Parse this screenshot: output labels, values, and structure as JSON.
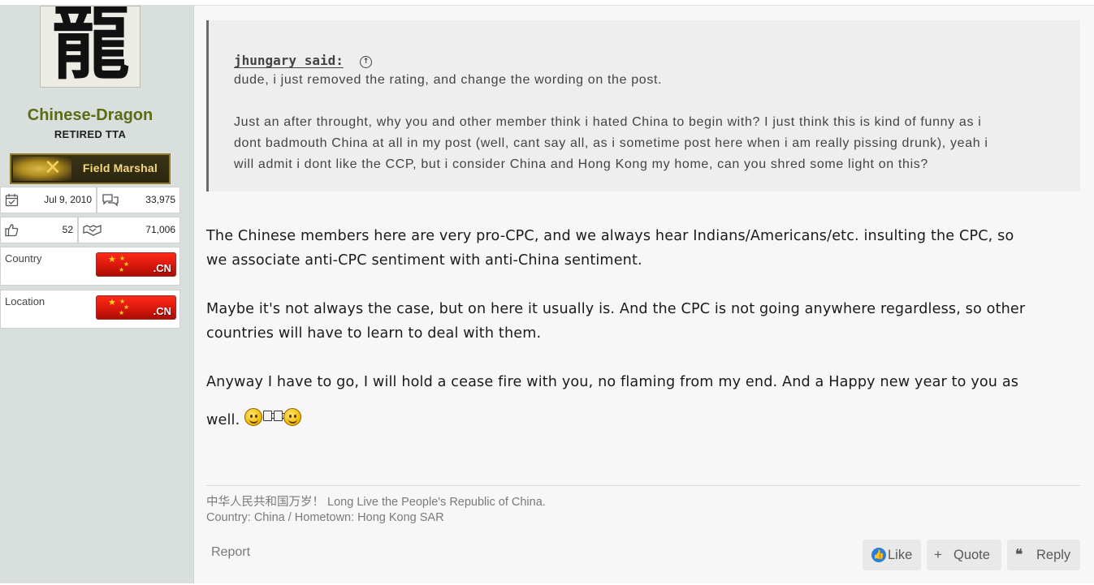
{
  "user": {
    "avatar_glyph": "龍",
    "name": "Chinese-Dragon",
    "title": "RETIRED TTA",
    "rank_label": "Field Marshal",
    "joined": "Jul 9, 2010",
    "messages": "33,975",
    "reactions": "52",
    "points": "71,006",
    "country_label": "Country",
    "country_flag_text": ".CN",
    "location_label": "Location",
    "location_flag_text": ".CN"
  },
  "post": {
    "quote": {
      "author": "jhungary said:",
      "paragraph_1": "dude, i just removed the rating, and change the wording on the post.",
      "paragraph_2_line_1": "Just an after throught, why you and other member think i hated China to begin with? I just think this is kind of funny as i",
      "paragraph_2_line_2": "dont badmouth China at all in my post (well, cant say all, as i sometime post here when i am really pissing drunk), yeah i",
      "paragraph_2_line_3": "will admit i dont like the CCP, but i consider China and Hong Kong my home, can you shred some light on this?"
    },
    "message": {
      "line_1": "The Chinese members here are very pro-CPC, and we always hear Indians/Americans/etc. insulting the CPC, so",
      "line_2": "we associate anti-CPC sentiment with anti-China sentiment.",
      "line_3": "Maybe it's not always the case, but on here it usually is. And the CPC is not going anywhere regardless, so other",
      "line_4": "countries will have to learn to deal with them.",
      "line_5": "Anyway I have to go, I will hold a cease fire with you, no flaming from my end. And a Happy new year to you as",
      "line_6": "well."
    },
    "signature": {
      "line_1": "中华人民共和国万岁！ Long Live the People's Republic of China.",
      "line_2": "Country: China / Hometown: Hong Kong SAR"
    },
    "actions": {
      "report": "Report",
      "like": "Like",
      "quote": "Quote",
      "reply": "Reply"
    }
  },
  "colors": {
    "username": "#5e6b14",
    "sidebar_bg": "#d9dfdc",
    "like_icon": "#2a80d8",
    "flag_red": "#d4160c"
  },
  "icons": [
    "calendar-icon",
    "speech-bubbles-icon",
    "thumbs-up-icon",
    "handshake-icon",
    "circle-arrow-up-icon",
    "plus-icon",
    "reply-quote-icon",
    "smiley-icon",
    "beer-mug-icon"
  ]
}
